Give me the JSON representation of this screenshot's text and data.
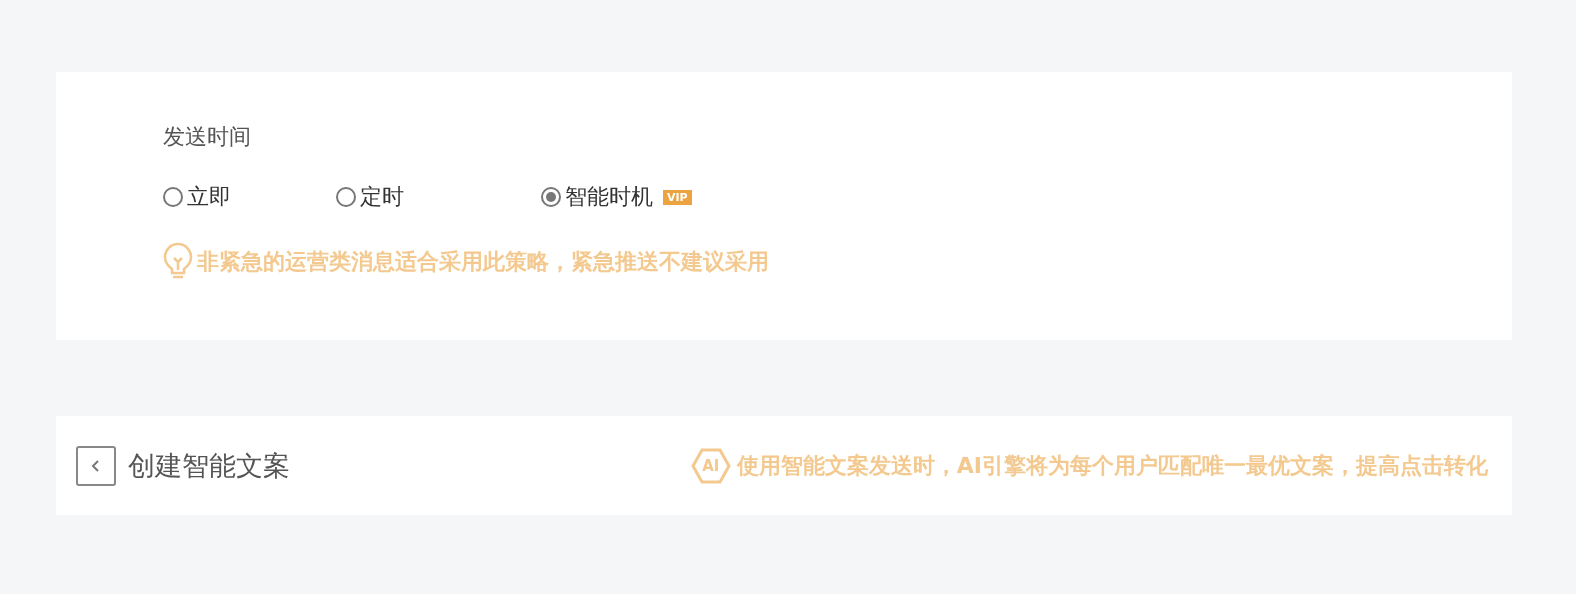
{
  "send_time": {
    "label": "发送时间",
    "options": [
      {
        "label": "立即",
        "selected": false
      },
      {
        "label": "定时",
        "selected": false
      },
      {
        "label": "智能时机",
        "selected": true,
        "badge": "VIP"
      }
    ],
    "tip": "非紧急的运营类消息适合采用此策略，紧急推送不建议采用"
  },
  "smart_copy": {
    "title": "创建智能文案",
    "ai_badge": "AI",
    "hint": "使用智能文案发送时，AI引擎将为每个用户匹配唯一最优文案，提高点击转化"
  }
}
